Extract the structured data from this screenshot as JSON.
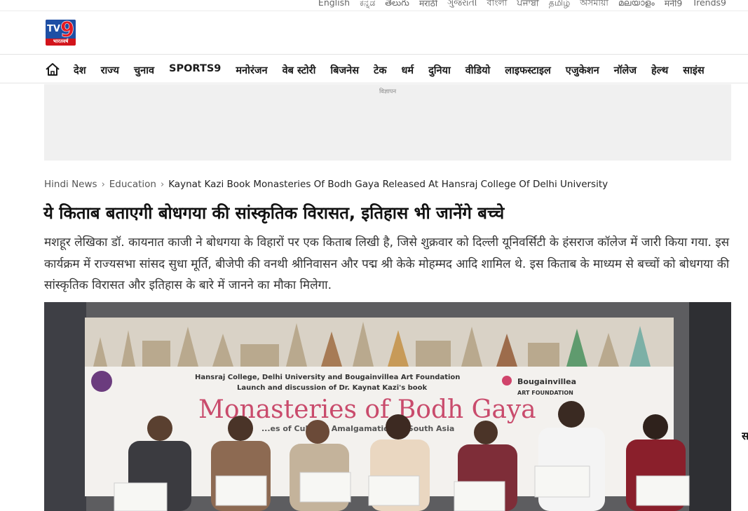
{
  "languages": [
    "English",
    "ಕನ್ನಡ",
    "తెలుగు",
    "मराठी",
    "ગુજરાતી",
    "বাংলা",
    "ਪੰਜਾਬੀ",
    "தமிழ்",
    "অসমীয়া",
    "മലയാളം",
    "मनी9",
    "Trends9"
  ],
  "logo": {
    "main": "TV",
    "number": "9",
    "subtitle": "भारतवर्ष"
  },
  "nav": {
    "home_icon": "home-icon",
    "items": [
      "देश",
      "राज्य",
      "चुनाव",
      "SPORTS9",
      "मनोरंजन",
      "वेब स्टोरी",
      "बिजनेस",
      "टेक",
      "धर्म",
      "दुनिया",
      "वीडियो",
      "लाइफस्टाइल",
      "एजुकेशन",
      "नॉलेज",
      "हेल्थ",
      "साइंस"
    ]
  },
  "ad": {
    "label": "विज्ञापन"
  },
  "breadcrumb": {
    "items": [
      "Hindi News",
      "Education"
    ],
    "current": "Kaynat Kazi Book Monasteries Of Bodh Gaya Released At Hansraj College Of Delhi University",
    "separator": "›"
  },
  "article": {
    "headline": "ये किताब बताएगी बोधगया की सांस्कृतिक विरासत, इतिहास भी जानेंगे बच्चे",
    "summary": "मशहूर लेखिका डॉ. कायनात काजी ने बोधगया के विहारों पर एक किताब लिखी है, जिसे शुक्रवार को दिल्ली यूनिवर्सिटी के हंसराज कॉलेज में जारी किया गया. इस कार्यक्रम में राज्यसभा सांसद सुधा मूर्ति, बीजेपी की वनथी श्रीनिवासन और पद्म श्री केके मोहम्मद आदि शामिल थे. इस किताब के माध्यम से बच्चों को बोधगया की सांस्कृतिक विरासत और इतिहास के बारे में जानने का मौका मिलेगा."
  },
  "hero_image": {
    "banner_line1": "Hansraj College, Delhi University and Bougainvillea Art Foundation",
    "banner_line2": "Launch and discussion of Dr. Kaynat Kazi's book",
    "banner_title": "Monasteries of Bodh Gaya",
    "banner_subtitle": "...es of Cultural Amalgamation in South Asia",
    "sponsor": "Bougainvillea",
    "sponsor_sub": "ART FOUNDATION"
  },
  "colors": {
    "brand_red": "#d2141b",
    "brand_blue": "#1e4fa5",
    "ad_bg": "#f0f0f0"
  }
}
